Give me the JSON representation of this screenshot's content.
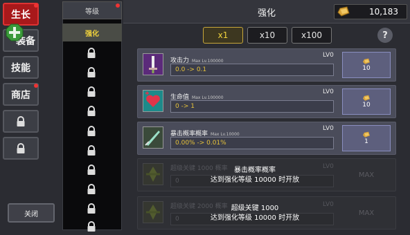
{
  "left_tabs": [
    {
      "label": "生长",
      "active": true,
      "dot": true
    },
    {
      "label": "装备",
      "active": false,
      "dot": false
    },
    {
      "label": "技能",
      "active": false,
      "dot": false
    },
    {
      "label": "商店",
      "active": false,
      "dot": true
    },
    {
      "label": "",
      "locked": true
    },
    {
      "label": "",
      "locked": true
    }
  ],
  "close_label": "关闭",
  "sub_tabs": {
    "levels": "等级",
    "enhance": "强化"
  },
  "header": {
    "title": "强化",
    "gold": "10,183"
  },
  "multipliers": [
    "x1",
    "x10",
    "x100"
  ],
  "help_label": "?",
  "stats": [
    {
      "name": "攻击力",
      "max": "Max Lv.100000",
      "lv": "LV0",
      "value": "0.0 -> 0.1",
      "cost": "10"
    },
    {
      "name": "生命值",
      "max": "Max Lv.100000",
      "lv": "LV0",
      "value": "0 -> 1",
      "cost": "10"
    },
    {
      "name": "暴击概率概率",
      "max": "Max Lv.10000",
      "lv": "LV0",
      "value": "0.00% -> 0.01%",
      "cost": "1"
    },
    {
      "name": "超级关键 1000 概率",
      "lv": "LV0",
      "value": "0",
      "button": "MAX",
      "tip1": "暴击概率概率",
      "tip2": "达到强化等级 10000 时开放"
    },
    {
      "name": "超级关键 2000 概率",
      "lv": "LV0",
      "value": "0",
      "button": "MAX",
      "tip1": "超级关键 1000",
      "tip2": "达到强化等级 10000 时开放"
    }
  ],
  "colors": {
    "accent_red": "#a8191b",
    "gold_text": "#f0d23c",
    "row_bg": "#4a4c5a"
  }
}
